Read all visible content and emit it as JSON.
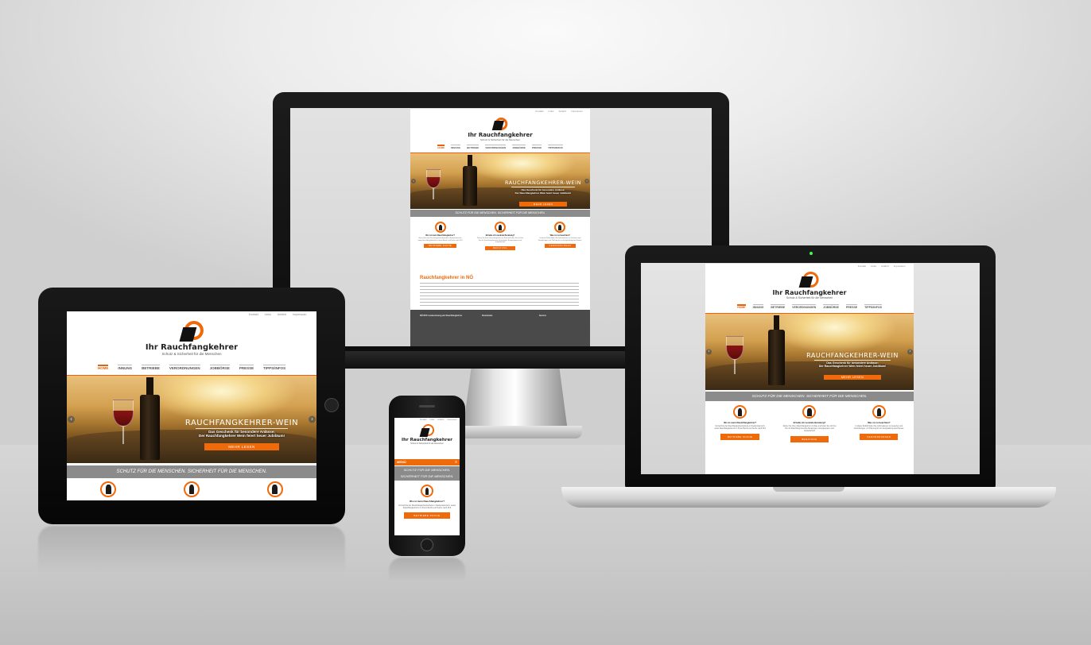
{
  "site": {
    "brand_title": "Ihr Rauchfangkehrer",
    "brand_tagline": "Schutz & Sicherheit für die Menschen",
    "utility_links": [
      "Kontakt",
      "Links",
      "Anfahrt",
      "Impressum"
    ],
    "nav": [
      "HOME",
      "INNUNG",
      "BETRIEBE",
      "VERORDNUNGEN",
      "JOBBÖRSE",
      "PRESSE",
      "TIPPS/INFOS"
    ],
    "nav_active": "HOME",
    "hero_title": "RAUCHFANGKEHRER-WEIN",
    "hero_line1": "Das Geschenk für besondere Anlässe:",
    "hero_line2": "Der Rauchfangkehrer Wein feiert heuer Jubiläum!",
    "hero_button": "MEHR LESEN",
    "band_text": "SCHUTZ FÜR DIE MENSCHEN. SICHERHEIT FÜR DIE MENSCHEN.",
    "band_line1": "SCHUTZ FÜR DIE MENSCHEN.",
    "band_line2": "SICHERHEIT FÜR DIE MENSCHEN.",
    "columns": [
      {
        "title": "Wo ist mein Rauchfangkehrer?",
        "text": "Verzeichnis der Rauchfangkehrerbetriebe in Niederösterreich, sowie Rauchfangkehrer/in in Ihrem Bezirk und Suche nach PLZ",
        "button": "BETRIEBE SUCHE"
      },
      {
        "title": "Erhalte ich neutrale Beratung?",
        "text": "Ziehen Sie Ihren Rauchfangkehrer zu Rate und holen Sie sich bei Ihm für Rauchfang-bereiche Beratungen, Energiesparen und Umweltschutz",
        "button": "BERATUNG"
      },
      {
        "title": "Was ist zu beachten?",
        "text": "In dieser Rubrik finden Sie Informationen zu Gesetzen und Verordnungen, zur Planung bis zur Fertigstellung des Hauses.",
        "button": "VERORDNUNGEN"
      }
    ],
    "intro_title": "Rauchfangkehrer in NÖ",
    "footer_cols": [
      "NÖ RFK Landesinnung der Rauchfangkehrer",
      "Downloads",
      "Service"
    ],
    "phone_menu": "MENÜ"
  },
  "colors": {
    "accent": "#ef6a0b",
    "band": "#8b8b8b",
    "footer": "#4a4a4a"
  }
}
